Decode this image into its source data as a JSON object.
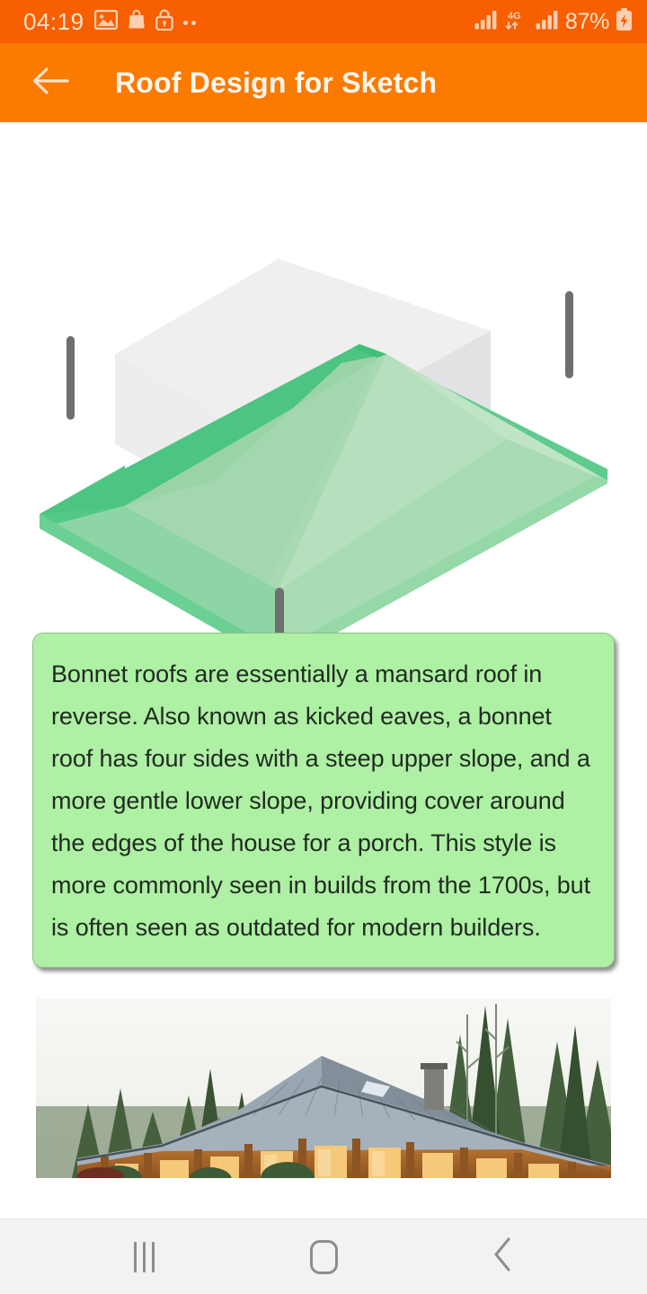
{
  "status_bar": {
    "time": "04:19",
    "battery_percent": "87%",
    "network_type": "4G",
    "icons": [
      "gallery-icon",
      "shopping-bag-icon",
      "lock-icon",
      "more-dots-icon",
      "signal-bars-icon",
      "network-4g-icon",
      "signal-bars-2-icon",
      "battery-charging-icon"
    ],
    "background_color": "#f75f00",
    "foreground_color": "#ffe3cf"
  },
  "app_bar": {
    "title": "Roof Design for Sketch",
    "back_icon": "arrow-left-icon",
    "background_color": "#fb7a00",
    "title_color": "#fff6ef"
  },
  "illustration": {
    "name": "bonnet-roof-3d-diagram",
    "roof_top_color": "#9fd4a9",
    "roof_highlight_color": "#b5dfbc",
    "roof_edge_color": "#45c07a",
    "roof_side_color": "#7fcf9a",
    "house_body_color": "#e4e4e4",
    "post_color": "#757575",
    "post_count": 3
  },
  "description_card": {
    "text": "Bonnet roofs are essentially a mansard roof in reverse. Also known as kicked eaves, a bonnet roof has four sides with a steep upper slope, and a more gentle lower slope, providing cover around the edges of the house for a porch. This style is more commonly seen in builds from the 1700s, but is often seen as outdated for modern builders.",
    "background_color": "#aef0a4",
    "border_color": "#8fbf88",
    "text_color": "#212b21"
  },
  "photo": {
    "name": "bonnet-roof-house-photo",
    "alt": "Wooden house with metal bonnet roof surrounded by evergreen trees",
    "sky_color": "#f4f5f2",
    "roof_color": "#8e9aa6",
    "wood_color": "#a8622c",
    "tree_color": "#3f5b38",
    "window_glow_color": "#f7c873"
  },
  "nav_bar": {
    "background_color": "#f2f2f2",
    "icon_color": "#8d8d8d",
    "buttons": [
      {
        "name": "recents-button",
        "icon": "recents-icon"
      },
      {
        "name": "home-button",
        "icon": "home-icon"
      },
      {
        "name": "back-button",
        "icon": "chevron-left-icon"
      }
    ]
  }
}
